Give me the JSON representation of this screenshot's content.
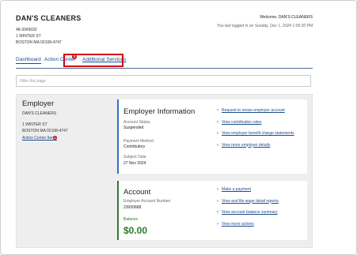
{
  "header": {
    "business_name": "DAN'S CLEANERS",
    "account_id": "48-3049032",
    "address_line1": "1 WINTER ST",
    "address_line2": "BOSTON MA 02108-4747",
    "welcome": "Welcome, DAN'S CLEANERS",
    "last_login": "You last logged in on Sunday, Dec 1, 2024 1:05:30 PM"
  },
  "tabs": {
    "dashboard": "Dashboard",
    "action_center": "Action Center",
    "action_center_count": "2",
    "additional_services": "Additional Services"
  },
  "filter": {
    "placeholder": "Filter this page"
  },
  "employer": {
    "heading": "Employer",
    "name": "DAN'S CLEANERS",
    "address_line1": "1 WINTER ST",
    "address_line2": "BOSTON MA 02108-4747",
    "action_items_label": "Action Center Items",
    "action_items_count": "1"
  },
  "employer_info": {
    "title": "Employer Information",
    "status_label": "Account Status",
    "status_value": "Suspended",
    "payment_label": "Payment Method",
    "payment_value": "Contributory",
    "subject_label": "Subject Date",
    "subject_value": "27 Nov 2024",
    "links": [
      "Request to revise employer account",
      "View contribution rates",
      "View employer benefit charge statements",
      "View more employer details"
    ]
  },
  "account": {
    "title": "Account",
    "number_label": "Employer Account Number",
    "number_value": "23000688",
    "balance_label": "Balance",
    "balance_value": "$0.00",
    "links": [
      "Make a payment",
      "View and file wage detail reports",
      "View account balance summary",
      "View more actions"
    ]
  },
  "colors": {
    "link": "#1a4d8f",
    "highlight_border": "#d0021b",
    "balance_green": "#2b7a2b",
    "info_accent": "#2f72c4",
    "badge_red": "#c8102e"
  }
}
